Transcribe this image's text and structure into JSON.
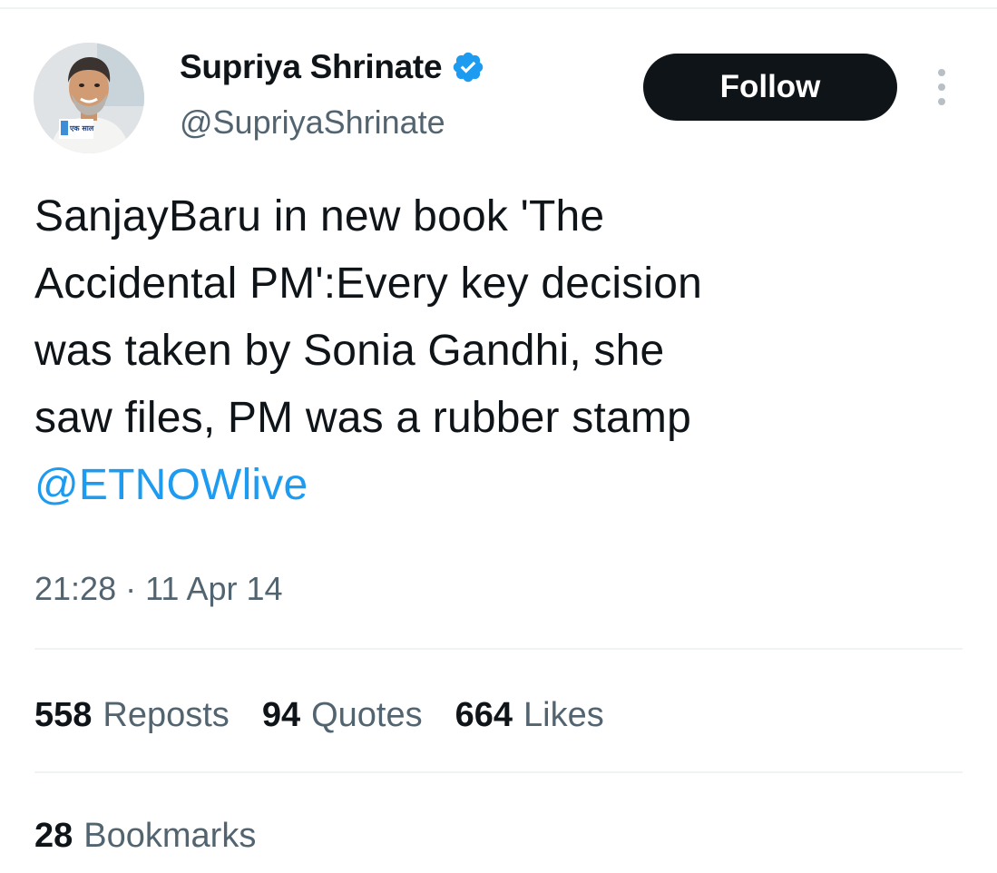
{
  "author": {
    "display_name": "Supriya Shrinate",
    "handle": "@SupriyaShrinate",
    "avatar_badge_text": "एक साल"
  },
  "actions": {
    "follow_label": "Follow"
  },
  "tweet": {
    "lines": [
      "SanjayBaru in new book 'The",
      "Accidental PM':Every key decision",
      "was taken by Sonia Gandhi, she",
      "saw files, PM was a rubber stamp"
    ],
    "mention": "@ETNOWlive",
    "timestamp": "21:28 · 11 Apr 14"
  },
  "stats": {
    "reposts": {
      "count": "558",
      "label": "Reposts"
    },
    "quotes": {
      "count": "94",
      "label": "Quotes"
    },
    "likes": {
      "count": "664",
      "label": "Likes"
    },
    "bookmarks": {
      "count": "28",
      "label": "Bookmarks"
    }
  },
  "colors": {
    "accent": "#1d9bf0",
    "text_primary": "#0f1419",
    "text_secondary": "#536471",
    "divider": "#eff3f4"
  }
}
